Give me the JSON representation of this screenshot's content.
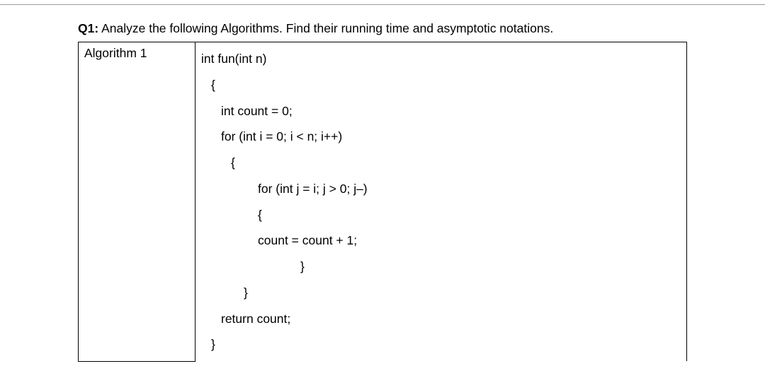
{
  "question": {
    "label": "Q1:",
    "text": " Analyze the following Algorithms. Find their running time and asymptotic notations."
  },
  "table": {
    "row_label": "Algorithm 1",
    "code": {
      "line1": "int fun(int n)",
      "line2": "{",
      "line3": "int count = 0;",
      "line4": "for (int i = 0; i < n; i++)",
      "line5": "{",
      "line6": "for (int j = i; j > 0; j–)",
      "line7": "{",
      "line8": "count = count + 1;",
      "line9": "}",
      "line10": "}",
      "line11": "return count;",
      "line12": "}"
    }
  }
}
